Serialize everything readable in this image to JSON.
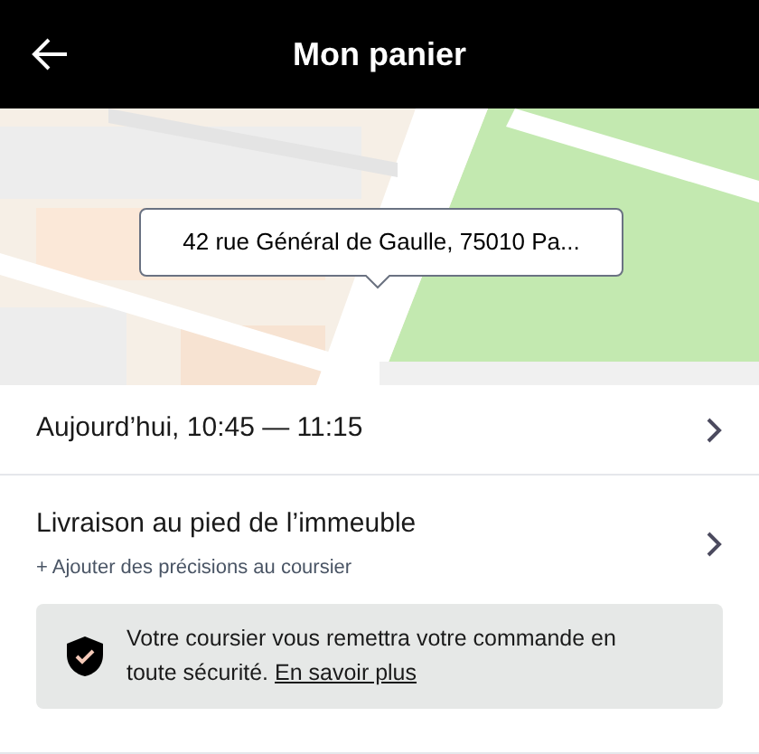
{
  "header": {
    "title": "Mon panier"
  },
  "map": {
    "kind": "picture",
    "address_callout": "42 rue Général de Gaulle, 75010 Pa..."
  },
  "rows": [
    {
      "title": "Aujourd’hui, 10:45 — 11:15"
    },
    {
      "title": "Livraison au pied de l’immeuble",
      "subtitle": "+ Ajouter des précisions au coursier"
    }
  ],
  "notice": {
    "text": "Votre coursier vous remettra votre commande en toute sécurité.",
    "link": "En savoir plus"
  }
}
